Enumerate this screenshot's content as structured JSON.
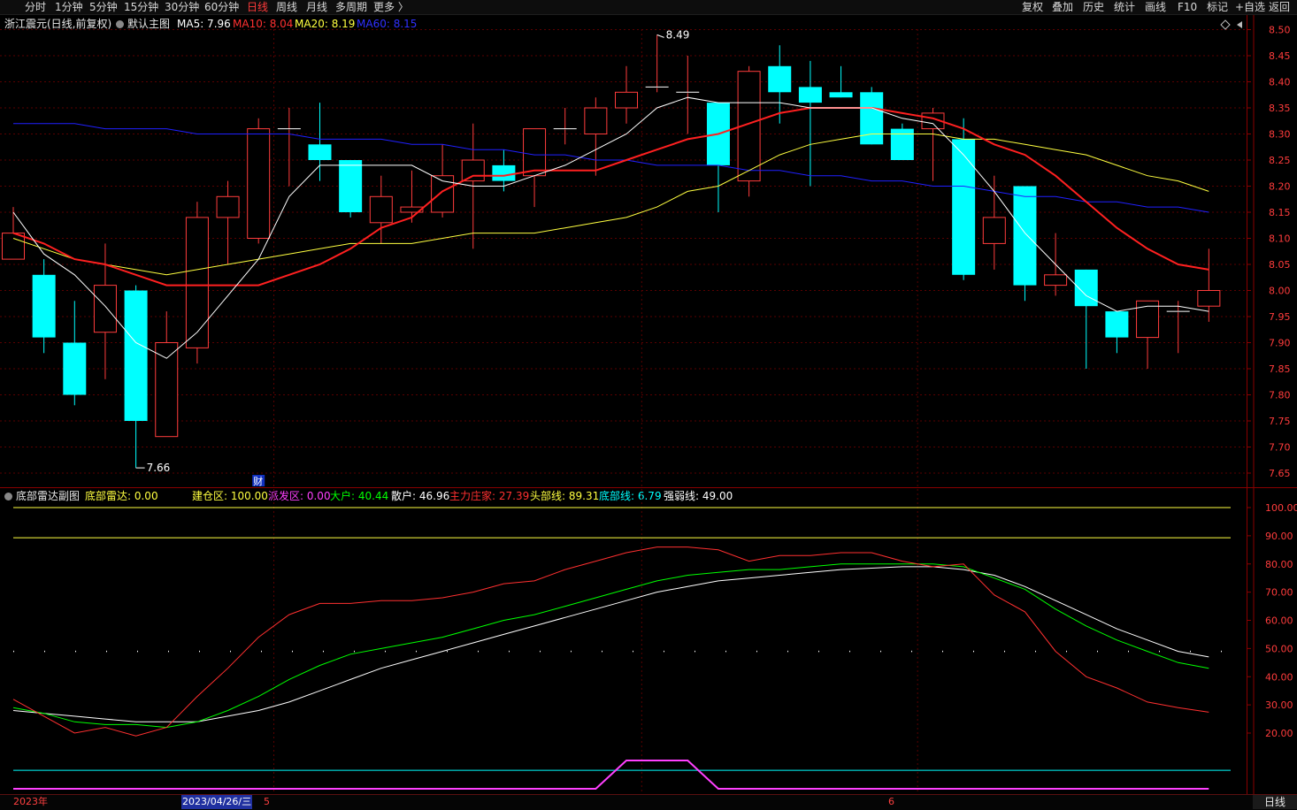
{
  "toolbar": {
    "periods": [
      {
        "label": "分时",
        "active": false
      },
      {
        "label": "1分钟",
        "active": false
      },
      {
        "label": "5分钟",
        "active": false
      },
      {
        "label": "15分钟",
        "active": false
      },
      {
        "label": "30分钟",
        "active": false
      },
      {
        "label": "60分钟",
        "active": false
      },
      {
        "label": "日线",
        "active": true
      },
      {
        "label": "周线",
        "active": false
      },
      {
        "label": "月线",
        "active": false
      },
      {
        "label": "多周期",
        "active": false
      },
      {
        "label": "更多 〉",
        "active": false
      }
    ],
    "right": [
      "复权",
      "叠加",
      "历史",
      "统计",
      "画线",
      "F10",
      "标记",
      "+自选",
      "返回"
    ]
  },
  "colors": {
    "up": "#ff3c3c",
    "down": "#00ffff",
    "ma5": "#ffffff",
    "ma10": "#ff2020",
    "ma20": "#ffff40",
    "ma60": "#2020ff",
    "grid": "#5a0000"
  },
  "main_legend": {
    "title": "浙江震元(日线,前复权)",
    "indicator": "默认主图",
    "ma5": "MA5: 7.96",
    "ma10": "MA10: 8.04",
    "ma20": "MA20: 8.19",
    "ma60": "MA60: 8.15"
  },
  "sub_legend": {
    "name": "底部雷达副图",
    "items": [
      {
        "text": "底部雷达: 0.00",
        "color": "#ffff40"
      },
      {
        "text": "建仓区: 100.00",
        "color": "#ffff40"
      },
      {
        "text": "派发区: 0.00",
        "color": "#ff40ff"
      },
      {
        "text": "大户: 40.44",
        "color": "#00ff00"
      },
      {
        "text": "散户: 46.96",
        "color": "#ffffff"
      },
      {
        "text": "主力庄家: 27.39",
        "color": "#ff3030"
      },
      {
        "text": "头部线: 89.31",
        "color": "#ffff40"
      },
      {
        "text": "底部线: 6.79",
        "color": "#00ffff"
      },
      {
        "text": "强弱线: 49.00",
        "color": "#ffffff"
      }
    ]
  },
  "bottom_bar": {
    "year": "2023年",
    "cursor_date": "2023/04/26/三",
    "month5": "5",
    "month6": "6",
    "period_tab": "日线"
  },
  "chart_data": [
    {
      "type": "candlestick",
      "name": "浙江震元(日线,前复权)",
      "ylim": [
        7.62,
        8.52
      ],
      "yticks": [
        7.65,
        7.7,
        7.75,
        7.8,
        7.85,
        7.9,
        7.95,
        8.0,
        8.05,
        8.1,
        8.15,
        8.2,
        8.25,
        8.3,
        8.35,
        8.4,
        8.45,
        8.5
      ],
      "grid": true,
      "candles": [
        {
          "o": 8.06,
          "h": 8.16,
          "l": 8.06,
          "c": 8.11
        },
        {
          "o": 8.03,
          "h": 8.06,
          "l": 7.88,
          "c": 7.91
        },
        {
          "o": 7.9,
          "h": 7.98,
          "l": 7.78,
          "c": 7.8
        },
        {
          "o": 7.92,
          "h": 8.09,
          "l": 7.83,
          "c": 8.01
        },
        {
          "o": 8.0,
          "h": 8.01,
          "l": 7.66,
          "c": 7.75
        },
        {
          "o": 7.72,
          "h": 7.96,
          "l": 7.72,
          "c": 7.9
        },
        {
          "o": 7.89,
          "h": 8.17,
          "l": 7.86,
          "c": 8.14
        },
        {
          "o": 8.14,
          "h": 8.21,
          "l": 8.05,
          "c": 8.18
        },
        {
          "o": 8.1,
          "h": 8.33,
          "l": 8.09,
          "c": 8.31
        },
        {
          "o": 8.31,
          "h": 8.35,
          "l": 8.2,
          "c": 8.31
        },
        {
          "o": 8.28,
          "h": 8.36,
          "l": 8.21,
          "c": 8.25
        },
        {
          "o": 8.25,
          "h": 8.25,
          "l": 8.14,
          "c": 8.15
        },
        {
          "o": 8.13,
          "h": 8.22,
          "l": 8.09,
          "c": 8.18
        },
        {
          "o": 8.15,
          "h": 8.23,
          "l": 8.13,
          "c": 8.16
        },
        {
          "o": 8.15,
          "h": 8.28,
          "l": 8.14,
          "c": 8.22
        },
        {
          "o": 8.21,
          "h": 8.32,
          "l": 8.08,
          "c": 8.25
        },
        {
          "o": 8.24,
          "h": 8.27,
          "l": 8.19,
          "c": 8.21
        },
        {
          "o": 8.22,
          "h": 8.31,
          "l": 8.16,
          "c": 8.31
        },
        {
          "o": 8.31,
          "h": 8.35,
          "l": 8.28,
          "c": 8.31
        },
        {
          "o": 8.3,
          "h": 8.37,
          "l": 8.22,
          "c": 8.35
        },
        {
          "o": 8.35,
          "h": 8.43,
          "l": 8.32,
          "c": 8.38
        },
        {
          "o": 8.39,
          "h": 8.49,
          "l": 8.38,
          "c": 8.39
        },
        {
          "o": 8.38,
          "h": 8.45,
          "l": 8.3,
          "c": 8.38
        },
        {
          "o": 8.36,
          "h": 8.36,
          "l": 8.15,
          "c": 8.24
        },
        {
          "o": 8.21,
          "h": 8.43,
          "l": 8.18,
          "c": 8.42
        },
        {
          "o": 8.43,
          "h": 8.47,
          "l": 8.32,
          "c": 8.38
        },
        {
          "o": 8.39,
          "h": 8.44,
          "l": 8.2,
          "c": 8.36
        },
        {
          "o": 8.38,
          "h": 8.43,
          "l": 8.37,
          "c": 8.37
        },
        {
          "o": 8.38,
          "h": 8.39,
          "l": 8.28,
          "c": 8.28
        },
        {
          "o": 8.31,
          "h": 8.32,
          "l": 8.25,
          "c": 8.25
        },
        {
          "o": 8.31,
          "h": 8.35,
          "l": 8.21,
          "c": 8.34
        },
        {
          "o": 8.29,
          "h": 8.33,
          "l": 8.02,
          "c": 8.03
        },
        {
          "o": 8.09,
          "h": 8.22,
          "l": 8.04,
          "c": 8.14
        },
        {
          "o": 8.2,
          "h": 8.2,
          "l": 7.98,
          "c": 8.01
        },
        {
          "o": 8.01,
          "h": 8.11,
          "l": 7.99,
          "c": 8.03
        },
        {
          "o": 8.04,
          "h": 8.04,
          "l": 7.85,
          "c": 7.97
        },
        {
          "o": 7.96,
          "h": 7.96,
          "l": 7.88,
          "c": 7.91
        },
        {
          "o": 7.91,
          "h": 7.98,
          "l": 7.85,
          "c": 7.98
        },
        {
          "o": 7.96,
          "h": 7.98,
          "l": 7.88,
          "c": 7.96
        },
        {
          "o": 7.97,
          "h": 8.08,
          "l": 7.94,
          "c": 8.0
        }
      ],
      "ma5": [
        8.15,
        8.07,
        8.03,
        7.97,
        7.9,
        7.87,
        7.92,
        7.99,
        8.06,
        8.18,
        8.24,
        8.24,
        8.24,
        8.24,
        8.21,
        8.2,
        8.2,
        8.22,
        8.24,
        8.27,
        8.3,
        8.35,
        8.37,
        8.36,
        8.36,
        8.36,
        8.35,
        8.35,
        8.35,
        8.33,
        8.32,
        8.26,
        8.19,
        8.11,
        8.05,
        7.99,
        7.96,
        7.97,
        7.97,
        7.96
      ],
      "ma10": [
        8.11,
        8.09,
        8.06,
        8.05,
        8.03,
        8.01,
        8.01,
        8.01,
        8.01,
        8.03,
        8.05,
        8.08,
        8.12,
        8.14,
        8.19,
        8.22,
        8.22,
        8.23,
        8.23,
        8.23,
        8.25,
        8.27,
        8.29,
        8.3,
        8.32,
        8.34,
        8.35,
        8.35,
        8.35,
        8.34,
        8.33,
        8.31,
        8.28,
        8.26,
        8.22,
        8.17,
        8.12,
        8.08,
        8.05,
        8.04
      ],
      "ma20": [
        8.1,
        8.08,
        8.06,
        8.05,
        8.04,
        8.03,
        8.04,
        8.05,
        8.06,
        8.07,
        8.08,
        8.09,
        8.09,
        8.09,
        8.1,
        8.11,
        8.11,
        8.11,
        8.12,
        8.13,
        8.14,
        8.16,
        8.19,
        8.2,
        8.23,
        8.26,
        8.28,
        8.29,
        8.3,
        8.3,
        8.3,
        8.29,
        8.29,
        8.28,
        8.27,
        8.26,
        8.24,
        8.22,
        8.21,
        8.19
      ],
      "ma60": [
        8.32,
        8.32,
        8.32,
        8.31,
        8.31,
        8.31,
        8.3,
        8.3,
        8.3,
        8.3,
        8.29,
        8.29,
        8.29,
        8.28,
        8.28,
        8.27,
        8.27,
        8.26,
        8.26,
        8.25,
        8.25,
        8.24,
        8.24,
        8.24,
        8.23,
        8.23,
        8.22,
        8.22,
        8.21,
        8.21,
        8.2,
        8.2,
        8.19,
        8.18,
        8.18,
        8.17,
        8.17,
        8.16,
        8.16,
        8.15
      ],
      "annotations": [
        {
          "text": "8.49",
          "index": 21,
          "value": 8.49
        },
        {
          "text": "7.66",
          "index": 4,
          "value": 7.66
        },
        {
          "text": "财",
          "index": 8,
          "value": 7.62
        }
      ]
    },
    {
      "type": "line",
      "name": "底部雷达副图",
      "ylim": [
        0,
        110
      ],
      "yticks": [
        20,
        30,
        40,
        50,
        60,
        70,
        80,
        90,
        100
      ],
      "grid": false,
      "hlines": [
        {
          "name": "建仓区",
          "value": 100,
          "color": "#ffff40"
        },
        {
          "name": "头部线",
          "value": 89.31,
          "color": "#ffff40"
        },
        {
          "name": "强弱线",
          "value": 49,
          "color": "#ffffff",
          "dotted": true
        },
        {
          "name": "底部线",
          "value": 6.79,
          "color": "#00ffff"
        }
      ],
      "series": [
        {
          "name": "散户",
          "color": "#ffffff",
          "values": [
            28,
            27,
            26,
            25,
            24,
            24,
            24,
            26,
            28,
            31,
            35,
            39,
            43,
            46,
            49,
            52,
            55,
            58,
            61,
            64,
            67,
            70,
            72,
            74,
            75,
            76,
            77,
            78,
            78.5,
            79,
            79,
            78,
            76,
            72,
            67,
            62,
            57,
            53,
            49,
            47
          ]
        },
        {
          "name": "大户",
          "color": "#00ff00",
          "values": [
            29,
            27,
            24,
            23,
            23,
            22,
            24,
            28,
            33,
            39,
            44,
            48,
            50,
            52,
            54,
            57,
            60,
            62,
            65,
            68,
            71,
            74,
            76,
            77,
            78,
            78,
            79,
            80,
            80,
            80,
            80,
            79,
            75,
            71,
            64,
            58,
            53,
            49,
            45,
            43
          ]
        },
        {
          "name": "主力庄家",
          "color": "#ff3030",
          "values": [
            32,
            26,
            20,
            22,
            19,
            22,
            33,
            43,
            54,
            62,
            66,
            66,
            67,
            67,
            68,
            70,
            73,
            74,
            78,
            81,
            84,
            86,
            86,
            85,
            81,
            83,
            83,
            84,
            84,
            81,
            79,
            80,
            69,
            63,
            49,
            40,
            36,
            31,
            29,
            27.39
          ]
        },
        {
          "name": "派发区",
          "color": "#ff40ff",
          "values": [
            0,
            0,
            0,
            0,
            0,
            0,
            0,
            0,
            0,
            0,
            0,
            0,
            0,
            0,
            0,
            0,
            0,
            0,
            0,
            0,
            10,
            10,
            10,
            0,
            0,
            0,
            0,
            0,
            0,
            0,
            0,
            0,
            0,
            0,
            0,
            0,
            0,
            0,
            0,
            0
          ]
        }
      ]
    }
  ]
}
